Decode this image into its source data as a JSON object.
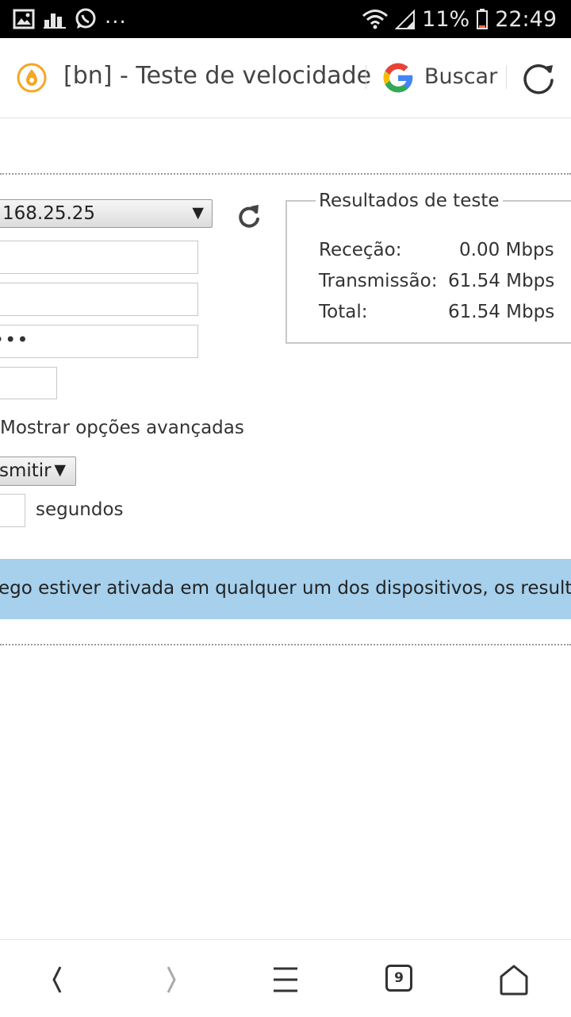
{
  "status_bar": {
    "notification_dots": "...",
    "battery_percent": "11%",
    "time": "22:49"
  },
  "toolbar": {
    "page_title": "[bn] - Teste de velocidade",
    "search_label": "Buscar"
  },
  "form": {
    "server_value": "168.25.25",
    "password_mask": "•••",
    "advanced_label": "Mostrar opções avançadas",
    "direction_value": "smitir",
    "seconds_label": "segundos"
  },
  "results": {
    "legend": "Resultados de teste",
    "rows": [
      {
        "label": "Receção:",
        "value": "0.00 Mbps"
      },
      {
        "label": "Transmissão:",
        "value": "61.54 Mbps"
      },
      {
        "label": "Total:",
        "value": "61.54 Mbps"
      }
    ]
  },
  "info_banner": {
    "text": "ego estiver ativada em qualquer um dos dispositivos, os resultado"
  },
  "bottom_nav": {
    "tab_count": "9"
  },
  "colors": {
    "banner_bg": "#a6d0ec",
    "status_bar_bg": "#000000",
    "site_icon_orange": "#f5a623"
  },
  "icons": [
    "gallery-icon",
    "chart-icon",
    "whatsapp-icon",
    "wifi-icon",
    "signal-icon",
    "battery-icon",
    "site-icon",
    "google-icon",
    "reload-icon",
    "refresh-icon",
    "back-icon",
    "forward-icon",
    "menu-icon",
    "tabs-icon",
    "home-icon"
  ]
}
